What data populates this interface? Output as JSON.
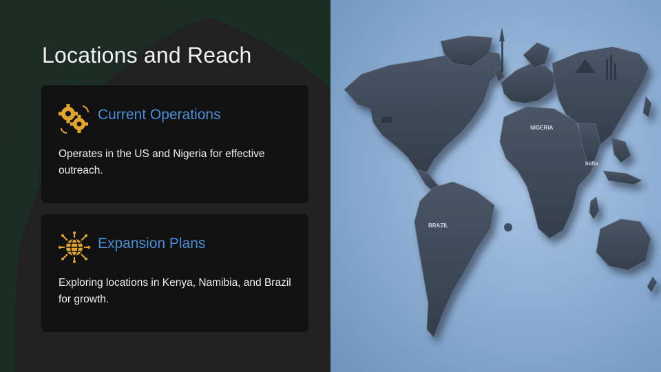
{
  "slide": {
    "title": "Locations and Reach"
  },
  "cards": [
    {
      "heading": "Current Operations",
      "body": "Operates in the US and Nigeria for effective outreach.",
      "icon": "gears-icon"
    },
    {
      "heading": "Expansion Plans",
      "body": "Exploring locations in Kenya, Namibia, and Brazil for growth.",
      "icon": "globe-network-icon"
    }
  ],
  "map": {
    "labels": {
      "nigeria": "NIGERIA",
      "brazil": "BRAZIL",
      "india": "India"
    }
  },
  "colors": {
    "accent_blue": "#4a8fd6",
    "icon_gold": "#e2a52c",
    "card_bg": "#111112",
    "map_bg": "#8fb0d4",
    "land": "#3c4654"
  }
}
